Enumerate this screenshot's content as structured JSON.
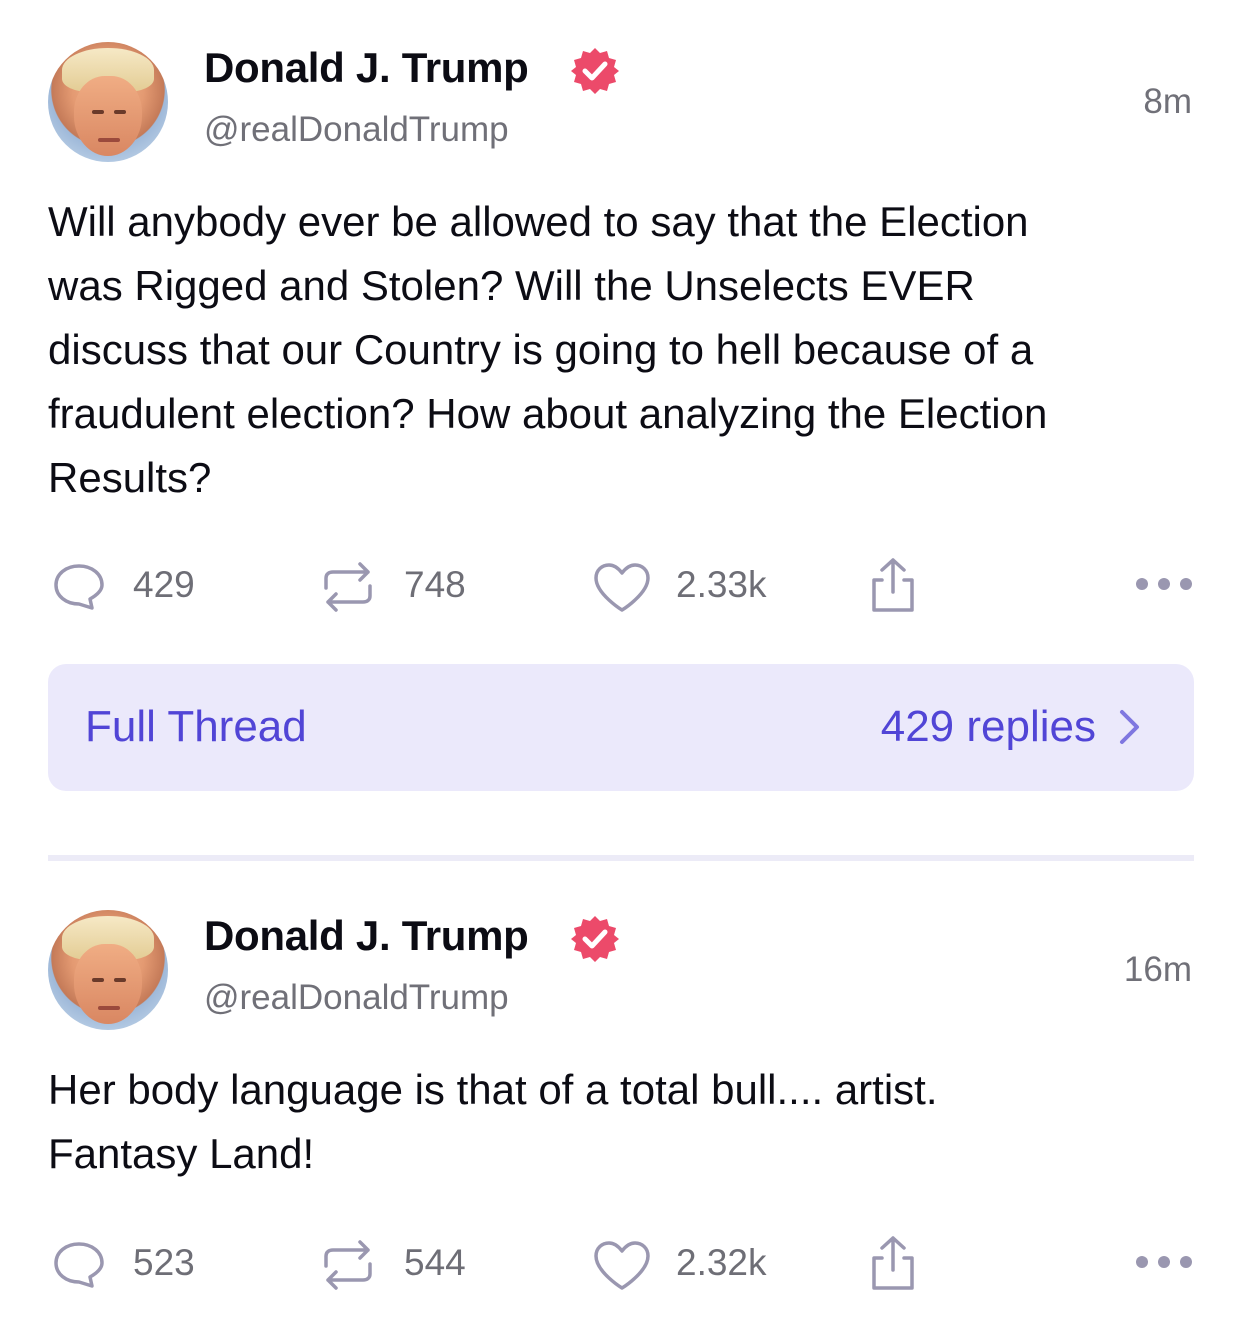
{
  "colors": {
    "accent": "#5145d6",
    "thread_bg": "#ebe9fb",
    "verified": "#ec4a6a",
    "muted": "#707078",
    "icon": "#9a97b0"
  },
  "posts": [
    {
      "author_name": "Donald J. Trump",
      "handle": "@realDonaldTrump",
      "time": "8m",
      "verified_icon": "verified-badge-icon",
      "text": "Will anybody ever be allowed to say that the Election\nwas Rigged and Stolen? Will the Unselects EVER\ndiscuss that our Country is going to hell because of a\nfraudulent election? How about analyzing the Election\nResults?",
      "replies": "429",
      "reposts": "748",
      "likes": "2.33k",
      "thread": {
        "label": "Full Thread",
        "replies_label": "429 replies"
      }
    },
    {
      "author_name": "Donald J. Trump",
      "handle": "@realDonaldTrump",
      "time": "16m",
      "verified_icon": "verified-badge-icon",
      "text": "Her body language is that of a total bull.... artist.\nFantasy Land!",
      "replies": "523",
      "reposts": "544",
      "likes": "2.32k"
    }
  ]
}
